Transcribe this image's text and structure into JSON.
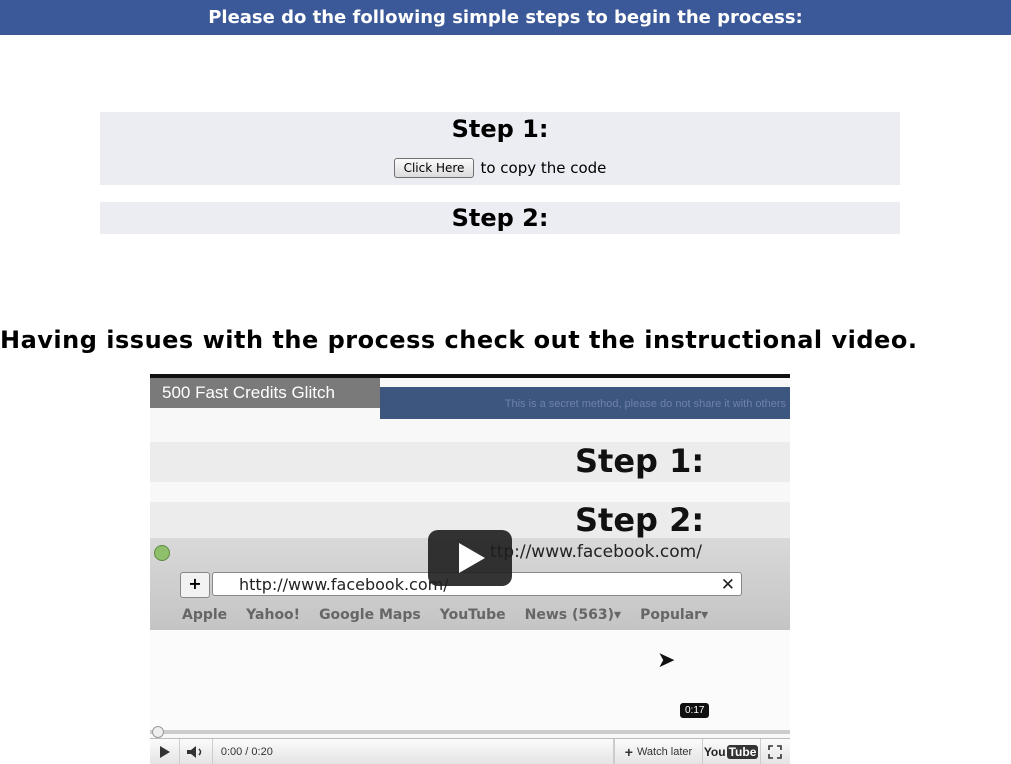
{
  "header": {
    "title": "Please do the following simple steps to begin the process:"
  },
  "step1": {
    "title": "Step 1:",
    "button_label": "Click Here",
    "suffix": "to copy the code"
  },
  "step2": {
    "title": "Step 2:"
  },
  "issues_text": "Having issues with the process check out the instructional video.",
  "video": {
    "title": "500 Fast Credits Glitch",
    "banner_text": "This is a secret method, please do not share it with others",
    "inner_step1": "Step 1:",
    "inner_step2": "Step 2:",
    "url_ghost": "ttp://www.facebook.com/",
    "url_text": "http://www.facebook.com/",
    "bookmarks": [
      "Apple",
      "Yahoo!",
      "Google Maps",
      "YouTube",
      "News (563)▾",
      "Popular▾"
    ],
    "tooltip_time": "0:17",
    "time_display": "0:00 / 0:20",
    "watch_later": "Watch later",
    "yt_you": "You",
    "yt_tube": "Tube",
    "progress": 0.0
  }
}
